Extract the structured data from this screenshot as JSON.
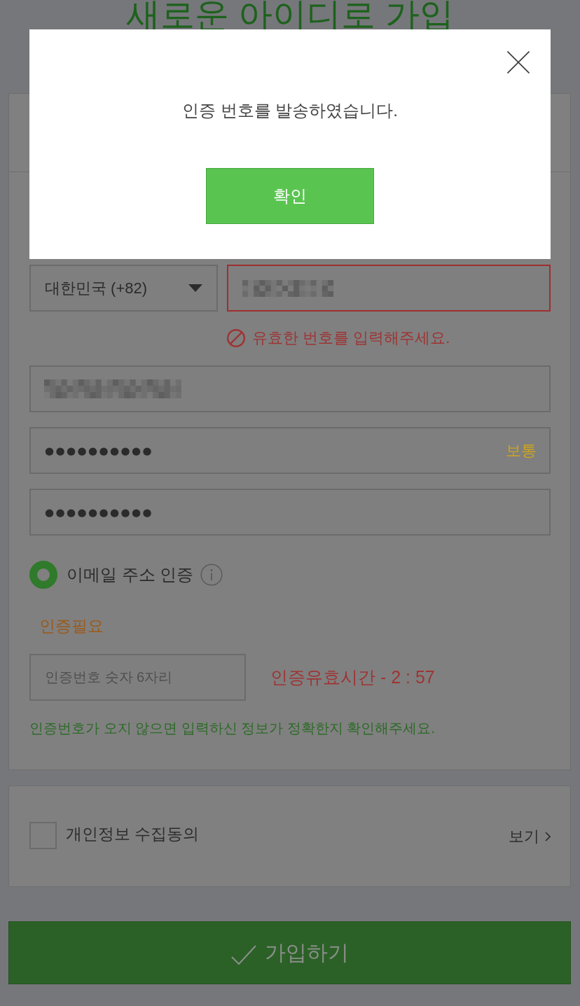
{
  "page_title": "새로운 아이디로 가입",
  "phone": {
    "country": "대한민국 (+82)",
    "value_redacted": true,
    "invalid": true,
    "error": "유효한 번호를 입력해주세요."
  },
  "email": {
    "value_redacted": true
  },
  "password": {
    "value": "●●●●●●●●●●",
    "strength": "보통"
  },
  "password_confirm": {
    "value": "●●●●●●●●●●"
  },
  "verification": {
    "method": "이메일 주소 인증",
    "selected": true,
    "status": "인증필요",
    "code_placeholder": "인증번호 숫자 6자리",
    "timer": "인증유효시간 - 2 : 57",
    "hint": "인증번호가 오지 않으면 입력하신 정보가 정확한지 확인해주세요."
  },
  "consent": {
    "label": "개인정보 수집동의",
    "checked": false,
    "link": "보기"
  },
  "submit": {
    "label": "가입하기"
  },
  "dialog": {
    "message": "인증 번호를 발송하였습니다.",
    "button": "확인"
  }
}
